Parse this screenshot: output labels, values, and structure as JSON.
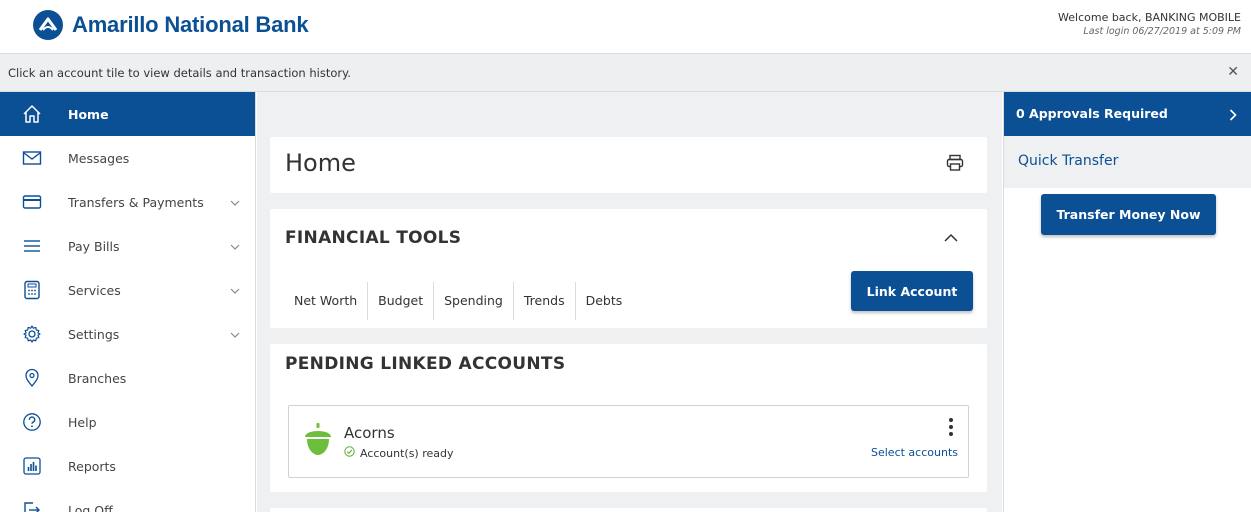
{
  "brand": {
    "name": "Amarillo National Bank",
    "color": "#0b4f95"
  },
  "header": {
    "welcome": "Welcome back, BANKING MOBILE",
    "last_login": "Last login 06/27/2019 at 5:09 PM"
  },
  "banner": {
    "text": "Click an account tile to view details and transaction history.",
    "close_glyph": "✕"
  },
  "sidebar": {
    "items": [
      {
        "label": "Home",
        "icon": "home-icon",
        "active": true
      },
      {
        "label": "Messages",
        "icon": "envelope-icon"
      },
      {
        "label": "Transfers & Payments",
        "icon": "credit-card-icon",
        "expandable": true
      },
      {
        "label": "Pay Bills",
        "icon": "menu-lines-icon",
        "expandable": true
      },
      {
        "label": "Services",
        "icon": "calculator-icon",
        "expandable": true
      },
      {
        "label": "Settings",
        "icon": "gear-icon",
        "expandable": true
      },
      {
        "label": "Branches",
        "icon": "map-pin-icon"
      },
      {
        "label": "Help",
        "icon": "question-icon"
      },
      {
        "label": "Reports",
        "icon": "bar-chart-icon"
      },
      {
        "label": "Log Off",
        "icon": "log-off-icon"
      }
    ]
  },
  "main": {
    "title": "Home",
    "financial_tools": {
      "title": "FINANCIAL TOOLS",
      "tools": [
        "Net Worth",
        "Budget",
        "Spending",
        "Trends",
        "Debts"
      ],
      "link_account_label": "Link Account"
    },
    "pending_linked_accounts": {
      "title": "PENDING LINKED ACCOUNTS",
      "accounts": [
        {
          "name": "Acorns",
          "status": "Account(s) ready",
          "action": "Select accounts",
          "icon": "acorn-icon"
        }
      ]
    }
  },
  "right_panel": {
    "approvals_label": "0  Approvals Required",
    "quick_transfer_label": "Quick Transfer",
    "transfer_button_label": "Transfer Money Now"
  }
}
